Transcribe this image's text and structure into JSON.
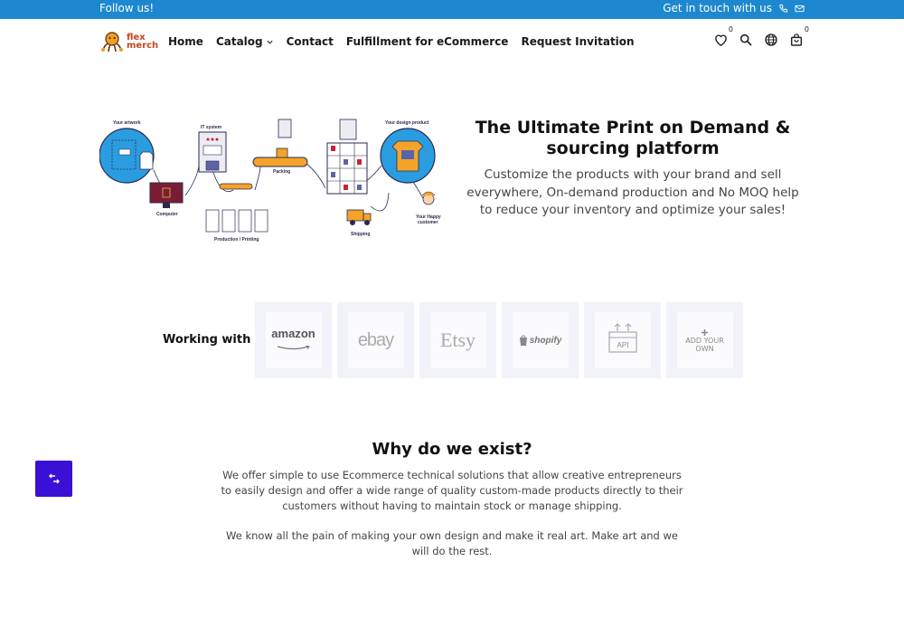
{
  "topbar": {
    "follow_text": "Follow us!",
    "contact_text": "Get in touch with us",
    "phone_icon": "phone-icon",
    "mail_icon": "mail-icon",
    "background": "#1d88cf"
  },
  "logo": {
    "line1": "flex",
    "line2": "merch"
  },
  "nav": {
    "home": "Home",
    "catalog": "Catalog",
    "contact": "Contact",
    "fulfillment": "Fulfillment for eCommerce",
    "request": "Request Invitation"
  },
  "header_icons": {
    "wishlist_count": "0",
    "cart_count": "0",
    "wishlist_icon": "heart-icon",
    "search_icon": "search-icon",
    "language_icon": "globe-icon",
    "cart_icon": "shopping-bag-icon"
  },
  "hero": {
    "title": "The Ultimate Print on Demand & sourcing platform",
    "subtitle": "Customize the products with your brand and sell everywhere, On-demand production and No MOQ help to reduce your inventory and optimize your sales!",
    "illustration": {
      "your_artwork": "Your artwork",
      "it_system": "IT system",
      "computer": "Computer",
      "production": "Production / Printing",
      "packing": "Packing",
      "your_design_product": "Your design product",
      "shipping": "Shipping",
      "happy_customer_1": "Your Happy",
      "happy_customer_2": "customer"
    }
  },
  "working": {
    "label": "Working with",
    "partners": [
      "amazon",
      "ebay",
      "Etsy",
      "shopify",
      "API",
      "ADD YOUR OWN"
    ]
  },
  "why": {
    "title": "Why do we exist?",
    "p1": "We offer simple to use Ecommerce technical solutions that allow creative entrepreneurs to easily design and offer a wide range of quality custom-made products directly to their customers without having to maintain stock or manage shipping.",
    "p2": "We know all the pain of making your own design and make it real art. Make art and we will do the rest."
  },
  "colors": {
    "accent": "#3a0fd6",
    "topbar": "#1d88cf"
  }
}
